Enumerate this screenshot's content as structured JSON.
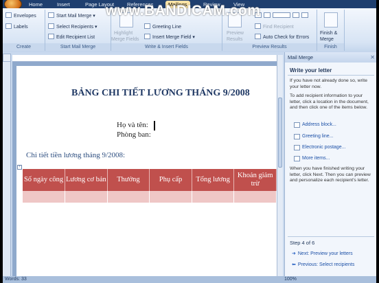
{
  "tabs": [
    "Home",
    "Insert",
    "Page Layout",
    "References",
    "Mailings",
    "Review",
    "View"
  ],
  "watermark": "www.BANDICAM.com",
  "ribbon": {
    "create": {
      "label": "Create",
      "envelopes": "Envelopes",
      "labels": "Labels"
    },
    "start": {
      "label": "Start Mail Merge",
      "start_mail_merge": "Start Mail Merge",
      "select_recipients": "Select Recipients",
      "edit_list": "Edit Recipient List"
    },
    "write": {
      "label": "Write & Insert Fields",
      "highlight": "Highlight",
      "merge_fields": "Merge Fields",
      "greeting_line": "Greeting Line",
      "insert_merge_field": "Insert Merge Field"
    },
    "preview": {
      "label": "Preview Results",
      "preview_line1": "Preview",
      "preview_line2": "Results",
      "find_recipient": "Find Recipient",
      "auto_check": "Auto Check for Errors"
    },
    "finish": {
      "label": "Finish",
      "finish_line1": "Finish &",
      "finish_line2": "Merge"
    }
  },
  "document": {
    "title": "BẢNG CHI TIẾT LƯƠNG THÁNG 9/2008",
    "name_label": "Họ và tên:",
    "dept_label": "Phòng ban:",
    "subtitle": "Chi tiết tiền lương tháng 9/2008:",
    "table_headers": [
      "Số ngày công",
      "Lương cơ bản",
      "Thưởng",
      "Phụ cấp",
      "Tổng lương",
      "Khoản giảm trừ"
    ]
  },
  "pane": {
    "title": "Mail Merge",
    "heading": "Write your letter",
    "p1": "If you have not already done so, write your letter now.",
    "p2": "To add recipient information to your letter, click a location in the document, and then click one of the items below.",
    "links": [
      "Address block...",
      "Greeting line...",
      "Electronic postage...",
      "More items..."
    ],
    "p3": "When you have finished writing your letter, click Next. Then you can preview and personalize each recipient's letter.",
    "step": "Step 4 of 6",
    "next": "Next: Preview your letters",
    "previous": "Previous: Select recipients"
  },
  "status": {
    "words": "Words: 33",
    "zoom": "100%"
  }
}
